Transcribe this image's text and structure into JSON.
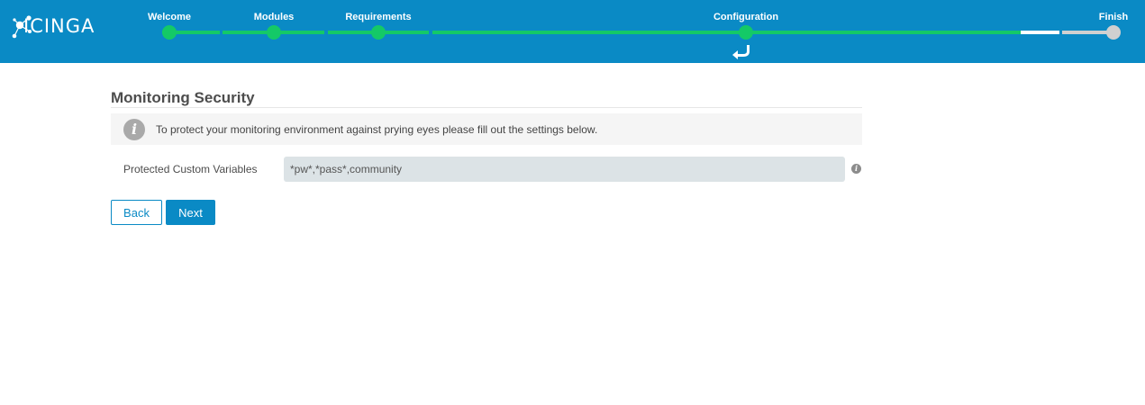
{
  "app": {
    "logo_text": "ICINGA"
  },
  "wizard": {
    "steps": [
      {
        "label": "Welcome",
        "state": "complete"
      },
      {
        "label": "Modules",
        "state": "complete"
      },
      {
        "label": "Requirements",
        "state": "complete"
      },
      {
        "label": "Configuration",
        "state": "current"
      },
      {
        "label": "Finish",
        "state": "pending"
      }
    ],
    "colors": {
      "header": "#0a8ac5",
      "complete": "#14c967",
      "pending": "#d0d0d0",
      "current_tail": "#ffffff"
    }
  },
  "page": {
    "title": "Monitoring Security",
    "info_text": "To protect your monitoring environment against prying eyes please fill out the settings below.",
    "field": {
      "label": "Protected Custom Variables",
      "value": "*pw*,*pass*,community"
    },
    "buttons": {
      "back": "Back",
      "next": "Next"
    }
  }
}
